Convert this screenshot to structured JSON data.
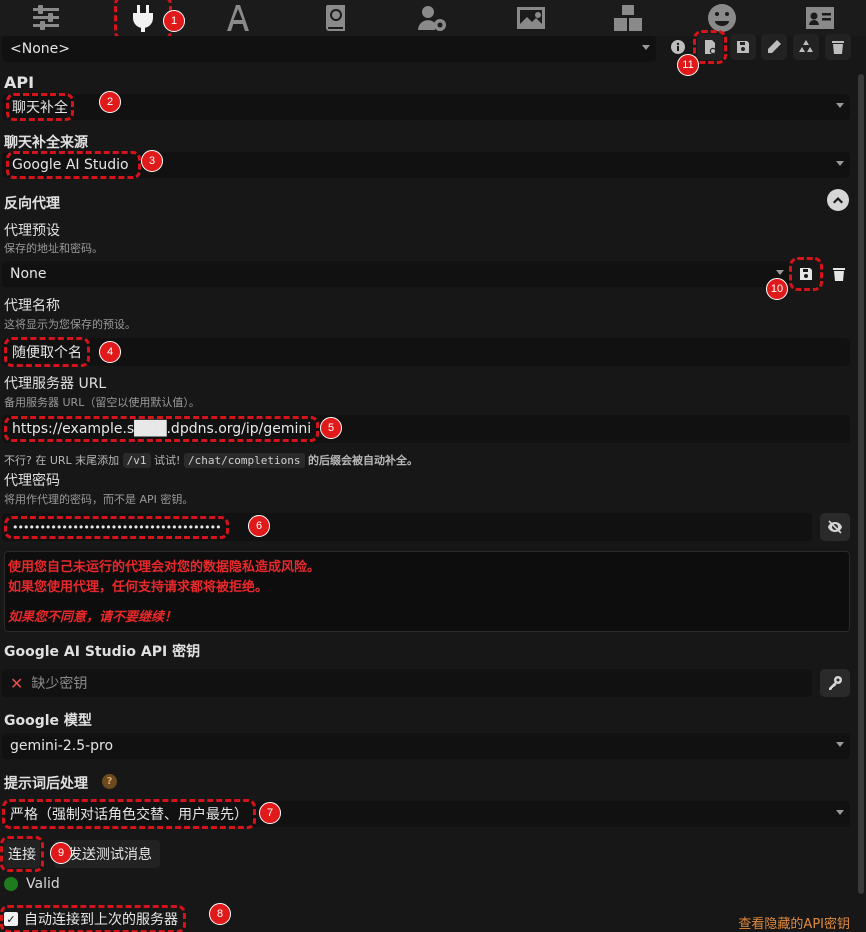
{
  "top_tabs": [
    "sliders-icon",
    "plug-icon",
    "font-icon",
    "globe-book-icon",
    "user-gear-icon",
    "image-icon",
    "cubes-icon",
    "smiley-icon",
    "id-card-icon"
  ],
  "preset": {
    "value": "<None>"
  },
  "api": {
    "label": "API",
    "value": "聊天补全"
  },
  "source": {
    "label": "聊天补全来源",
    "value": "Google AI Studio"
  },
  "reverse_proxy": {
    "label": "反向代理"
  },
  "proxy_preset": {
    "label": "代理预设",
    "hint": "保存的地址和密码。",
    "value": "None"
  },
  "proxy_name": {
    "label": "代理名称",
    "hint": "这将显示为您保存的预设。",
    "value": "随便取个名"
  },
  "proxy_url": {
    "label": "代理服务器 URL",
    "hint": "备用服务器 URL（留空以使用默认值）。",
    "value": "https://example.s███.dpdns.org/ip/gemini",
    "note_1": "不行? 在 URL 末尾添加",
    "code_1": "/v1",
    "note_2": "试试!",
    "code_2": "/chat/completions",
    "note_3": "的后缀会被自动补全。"
  },
  "proxy_password": {
    "label": "代理密码",
    "hint": "将用作代理的密码，而不是 API 密钥。",
    "value": "••••••••••••••••••••••••••••••••••••••"
  },
  "warning": {
    "line1": "使用您自己未运行的代理会对您的数据隐私造成风险。",
    "line2": "如果您使用代理，任何支持请求都将被拒绝。",
    "line3": "如果您不同意，请不要继续！"
  },
  "api_key": {
    "label": "Google AI Studio API 密钥",
    "placeholder": "缺少密钥"
  },
  "model": {
    "label": "Google 模型",
    "value": "gemini-2.5-pro"
  },
  "post_processing": {
    "label": "提示词后处理",
    "value": "严格（强制对话角色交替、用户最先）"
  },
  "connect": {
    "label": "连接",
    "test_label": "发送测试消息"
  },
  "status": {
    "text": "Valid"
  },
  "auto_connect": {
    "label": "自动连接到上次的服务器",
    "checked": true
  },
  "view_keys": {
    "label": "查看隐藏的API密钥"
  },
  "annotations": [
    "1",
    "2",
    "3",
    "4",
    "5",
    "6",
    "7",
    "8",
    "9",
    "10",
    "11"
  ],
  "colors": {
    "annotation": "#d4141a",
    "warning_text": "#e8282b",
    "valid": "#1e7b1e",
    "link": "#e08a3c"
  }
}
